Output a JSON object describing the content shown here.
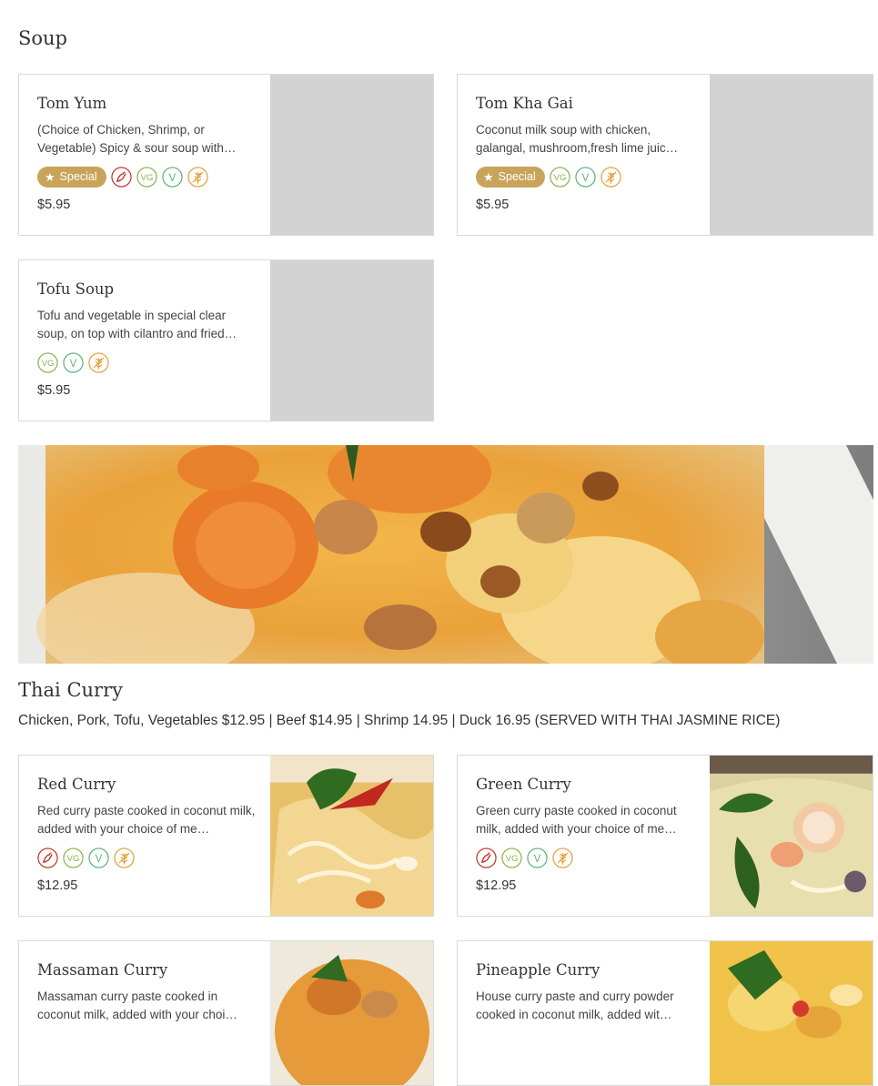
{
  "sections": {
    "soup": {
      "title": "Soup",
      "items": [
        {
          "name": "Tom Yum",
          "description": "(Choice of Chicken, Shrimp, or Vegetable) Spicy & sour soup with…",
          "price": "$5.95",
          "special_label": "Special",
          "tags": [
            "spicy",
            "vegan",
            "vegetarian",
            "gluten-free"
          ]
        },
        {
          "name": "Tom Kha Gai",
          "description": "Coconut milk soup with chicken, galangal, mushroom,fresh lime juic…",
          "price": "$5.95",
          "special_label": "Special",
          "tags": [
            "vegan",
            "vegetarian",
            "gluten-free"
          ]
        },
        {
          "name": "Tofu Soup",
          "description": "Tofu and vegetable in special clear soup, on top with cilantro and fried…",
          "price": "$5.95",
          "tags": [
            "vegan",
            "vegetarian",
            "gluten-free"
          ]
        }
      ]
    },
    "curry": {
      "title": "Thai Curry",
      "subtitle": "Chicken, Pork, Tofu, Vegetables $12.95 | Beef $14.95 | Shrimp 14.95 | Duck 16.95 (SERVED WITH THAI JASMINE RICE)",
      "items": [
        {
          "name": "Red Curry",
          "description": "Red curry paste cooked in coconut milk, added with your choice of me…",
          "price": "$12.95",
          "tags": [
            "spicy",
            "vegan",
            "vegetarian",
            "gluten-free"
          ]
        },
        {
          "name": "Green Curry",
          "description": "Green curry paste cooked in coconut milk, added with your choice of me…",
          "price": "$12.95",
          "tags": [
            "spicy",
            "vegan",
            "vegetarian",
            "gluten-free"
          ]
        },
        {
          "name": "Massaman Curry",
          "description": "Massaman curry paste cooked in coconut milk, added with your choi…",
          "price": "",
          "tags": []
        },
        {
          "name": "Pineapple Curry",
          "description": "House curry paste and curry powder cooked in coconut milk, added wit…",
          "price": "",
          "tags": []
        }
      ]
    }
  },
  "badges": {
    "vegan": "VG",
    "vegetarian": "V"
  },
  "colors": {
    "special": "#c8a45a",
    "spicy": "#c0392b",
    "vegan": "#8bb34a",
    "vegetarian": "#5db37e",
    "gluten_free": "#e3a13b",
    "placeholder": "#d3d3d3"
  }
}
